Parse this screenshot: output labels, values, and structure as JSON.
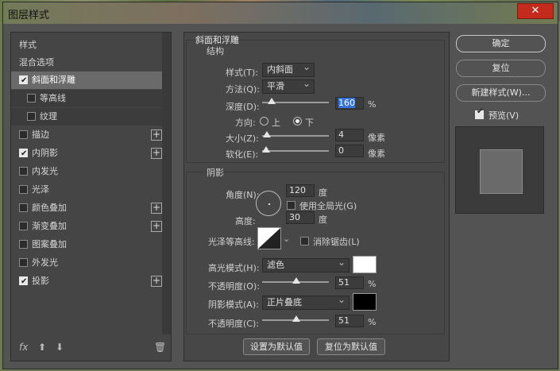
{
  "window": {
    "title": "图层样式",
    "close_symbol": "✕"
  },
  "sidebar": {
    "header": "样式",
    "blend": "混合选项",
    "items": [
      {
        "label": "斜面和浮雕",
        "checked": true,
        "selected": true
      },
      {
        "label": "等高线",
        "checked": false,
        "sub": true
      },
      {
        "label": "纹理",
        "checked": false,
        "sub": true
      },
      {
        "label": "描边",
        "checked": false,
        "plus": true
      },
      {
        "label": "内阴影",
        "checked": true,
        "plus": true
      },
      {
        "label": "内发光",
        "checked": false
      },
      {
        "label": "光泽",
        "checked": false
      },
      {
        "label": "颜色叠加",
        "checked": false,
        "plus": true
      },
      {
        "label": "渐变叠加",
        "checked": false,
        "plus": true
      },
      {
        "label": "图案叠加",
        "checked": false
      },
      {
        "label": "外发光",
        "checked": false
      },
      {
        "label": "投影",
        "checked": true,
        "plus": true
      }
    ],
    "fx": "fx",
    "up_icon": "⬆",
    "down_icon": "⬇",
    "trash_icon": "🗑"
  },
  "bevel": {
    "section_title": "斜面和浮雕",
    "structure_title": "结构",
    "style_label": "样式(T):",
    "style_value": "内斜面",
    "method_label": "方法(Q):",
    "method_value": "平滑",
    "depth_label": "深度(D):",
    "depth_value": "160",
    "depth_unit": "%",
    "depth_fraction": 0.1,
    "direction_label": "方向:",
    "dir_up": "上",
    "dir_down": "下",
    "size_label": "大小(Z):",
    "size_value": "4",
    "size_unit": "像素",
    "size_fraction": 0.02,
    "soften_label": "软化(E):",
    "soften_value": "0",
    "soften_unit": "像素",
    "soften_fraction": 0.0
  },
  "shading": {
    "title": "阴影",
    "angle_label": "角度(N):",
    "angle_value": "120",
    "angle_unit": "度",
    "global_light": "使用全局光(G)",
    "altitude_label": "高度:",
    "altitude_value": "30",
    "altitude_unit": "度",
    "gloss_label": "光泽等高线:",
    "antialias": "消除锯齿(L)",
    "highlight_mode_label": "高光模式(H):",
    "highlight_mode": "滤色",
    "highlight_color": "#ffffff",
    "highlight_opacity_label": "不透明度(O):",
    "highlight_opacity": "51",
    "highlight_opacity_unit": "%",
    "shadow_mode_label": "阴影模式(A):",
    "shadow_mode": "正片叠底",
    "shadow_color": "#000000",
    "shadow_opacity_label": "不透明度(C):",
    "shadow_opacity": "51",
    "shadow_opacity_unit": "%",
    "opacity_fraction": 0.51
  },
  "footer": {
    "set_default": "设置为默认值",
    "reset_default": "复位为默认值"
  },
  "actions": {
    "ok": "确定",
    "reset": "复位",
    "new_style": "新建样式(W)...",
    "preview": "预览(V)",
    "preview_checked": true
  }
}
